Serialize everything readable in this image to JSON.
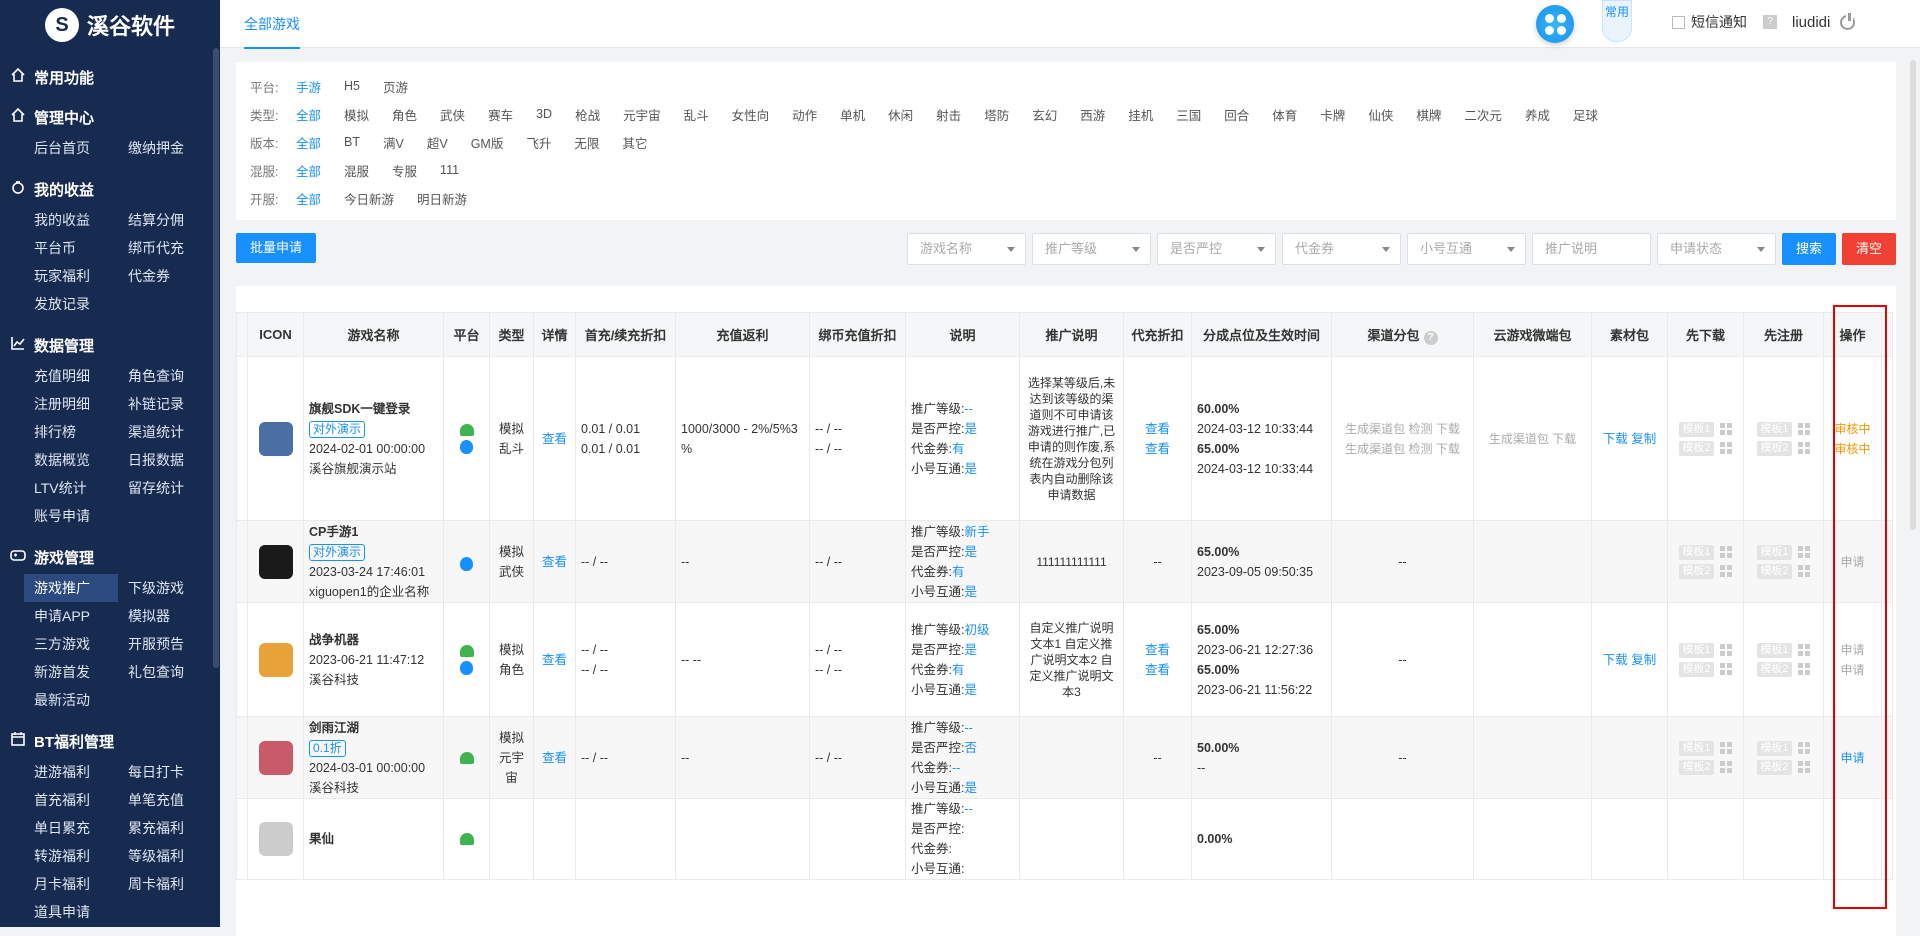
{
  "brand": {
    "name": "溪谷软件",
    "glyph": "S"
  },
  "sidebar": {
    "sections": [
      {
        "title": "常用功能",
        "icon": "home-icon",
        "items": []
      },
      {
        "title": "管理中心",
        "icon": "home-icon",
        "items": [
          "后台首页",
          "缴纳押金"
        ]
      },
      {
        "title": "我的收益",
        "icon": "money-bag-icon",
        "items": [
          "我的收益",
          "结算分佣",
          "平台币",
          "绑币代充",
          "玩家福利",
          "代金券",
          "发放记录"
        ]
      },
      {
        "title": "数据管理",
        "icon": "chart-line-icon",
        "items": [
          "充值明细",
          "角色查询",
          "注册明细",
          "补链记录",
          "排行榜",
          "渠道统计",
          "数据概览",
          "日报数据",
          "LTV统计",
          "留存统计",
          "账号申请"
        ]
      },
      {
        "title": "游戏管理",
        "icon": "gamepad-icon",
        "items": [
          "游戏推广",
          "下级游戏",
          "申请APP",
          "模拟器",
          "三方游戏",
          "开服预告",
          "新游首发",
          "礼包查询",
          "最新活动"
        ]
      },
      {
        "title": "BT福利管理",
        "icon": "calendar-icon",
        "items": [
          "进游福利",
          "每日打卡",
          "首充福利",
          "单笔充值",
          "单日累充",
          "累充福利",
          "转游福利",
          "等级福利",
          "月卡福利",
          "周卡福利",
          "道具申请"
        ]
      }
    ],
    "active_item": "游戏推广"
  },
  "topbar": {
    "tab": "全部游戏",
    "common": "常用",
    "sms": "短信通知",
    "help": "?",
    "user": "liudidi"
  },
  "filters": [
    {
      "label": "平台:",
      "options": [
        "手游",
        "H5",
        "页游"
      ],
      "selected": 0
    },
    {
      "label": "类型:",
      "options": [
        "全部",
        "模拟",
        "角色",
        "武侠",
        "赛车",
        "3D",
        "枪战",
        "元宇宙",
        "乱斗",
        "女性向",
        "动作",
        "单机",
        "休闲",
        "射击",
        "塔防",
        "玄幻",
        "西游",
        "挂机",
        "三国",
        "回合",
        "体育",
        "卡牌",
        "仙侠",
        "棋牌",
        "二次元",
        "养成",
        "足球"
      ],
      "selected": 0
    },
    {
      "label": "版本:",
      "options": [
        "全部",
        "BT",
        "满V",
        "超V",
        "GM版",
        "飞升",
        "无限",
        "其它"
      ],
      "selected": 0
    },
    {
      "label": "混服:",
      "options": [
        "全部",
        "混服",
        "专服",
        "111"
      ],
      "selected": 0
    },
    {
      "label": "开服:",
      "options": [
        "全部",
        "今日新游",
        "明日新游"
      ],
      "selected": 0
    }
  ],
  "toolbar": {
    "batch": "批量申请",
    "selects": [
      "游戏名称",
      "推广等级",
      "是否严控",
      "代金券",
      "小号互通"
    ],
    "input": "推广说明",
    "status": "申请状态",
    "search": "搜索",
    "clear": "清空"
  },
  "table": {
    "headers": [
      "ICON",
      "游戏名称",
      "平台",
      "类型",
      "详情",
      "首充/续充折扣",
      "充值返利",
      "绑币充值折扣",
      "说明",
      "推广说明",
      "代充折扣",
      "分成点位及生效时间",
      "渠道分包",
      "云游戏微端包",
      "素材包",
      "先下载",
      "先注册",
      "操作"
    ],
    "labels": {
      "level": "推广等级:",
      "strict": "是否严控:",
      "voucher": "代金券:",
      "alt": "小号互通:",
      "view": "查看",
      "gen": "生成渠道包",
      "check": "检测",
      "download": "下载",
      "copy": "复制",
      "cloud_gen": "生成渠道包",
      "tpl1": "模板1",
      "tpl2": "模板2"
    },
    "rows": [
      {
        "name": "旗舰SDK一键登录",
        "tag": "对外演示",
        "date": "2024-02-01 00:00:00",
        "company": "溪谷旗舰演示站",
        "icon_color": "#4a6fa5",
        "platforms": [
          "android",
          "ios"
        ],
        "type1": "模拟",
        "type2": "乱斗",
        "discount": [
          "0.01 / 0.01",
          "0.01 / 0.01"
        ],
        "rebate": "1000/3000 - 2%/5%3 %",
        "bind": [
          "-- / --",
          "-- / --"
        ],
        "level": "--",
        "strict": "是",
        "voucher": "有",
        "alt": "是",
        "promo": "选择某等级后,未达到该等级的渠道则不可申请该游戏进行推广,已申请的则作废,系统在游戏分包列表内自动删除该申请数据",
        "agent": [
          "查看",
          "查看"
        ],
        "share": [
          [
            "60.00%",
            "2024-03-12 10:33:44"
          ],
          [
            "65.00%",
            "2024-03-12 10:33:44"
          ]
        ],
        "channel": true,
        "cloud": true,
        "material": true,
        "ops": [
          "审核中",
          "审核中"
        ],
        "op_color": "orange"
      },
      {
        "name": "CP手游1",
        "tag": "对外演示",
        "date": "2023-03-24 17:46:01",
        "company": "xiguopen1的企业名称",
        "icon_color": "#1a1a1a",
        "platforms": [
          "ios"
        ],
        "type1": "模拟",
        "type2": "武侠",
        "discount": [
          "-- / --"
        ],
        "rebate": "--",
        "bind": [
          "-- / --"
        ],
        "level": "新手",
        "strict": "是",
        "voucher": "有",
        "alt": "是",
        "promo": "111111111111",
        "agent": [
          "--"
        ],
        "share": [
          [
            "65.00%",
            "2023-09-05 09:50:35"
          ]
        ],
        "channel": false,
        "cloud_text": "--",
        "material": false,
        "ops": [
          "申请"
        ],
        "op_color": "gray"
      },
      {
        "name": "战争机器",
        "tag": "",
        "date": "2023-06-21 11:47:12",
        "company": "溪谷科技",
        "icon_color": "#e8a23a",
        "platforms": [
          "android",
          "ios"
        ],
        "type1": "模拟",
        "type2": "角色",
        "discount": [
          "-- / --",
          "-- / --"
        ],
        "rebate": "-- --",
        "bind": [
          "-- / --",
          "-- / --"
        ],
        "level": "初级",
        "strict": "是",
        "voucher": "有",
        "alt": "是",
        "promo": "自定义推广说明文本1 自定义推广说明文本2 自定义推广说明文本3",
        "agent": [
          "查看",
          "查看"
        ],
        "share": [
          [
            "65.00%",
            "2023-06-21 12:27:36"
          ],
          [
            "65.00%",
            "2023-06-21 11:56:22"
          ]
        ],
        "channel": false,
        "cloud_text": "--",
        "material": true,
        "ops": [
          "申请",
          "申请"
        ],
        "op_color": "gray"
      },
      {
        "name": "剑雨江湖",
        "tag": "0.1折",
        "date": "2024-03-01 00:00:00",
        "company": "溪谷科技",
        "icon_color": "#c85a6a",
        "platforms": [
          "android"
        ],
        "type1": "模拟",
        "type2": "元宇宙",
        "discount": [
          "-- / --"
        ],
        "rebate": "--",
        "bind": [
          "-- / --"
        ],
        "level": "--",
        "strict": "否",
        "voucher": "--",
        "alt": "是",
        "promo": "",
        "agent": [
          "--"
        ],
        "share": [
          [
            "50.00%",
            "--"
          ]
        ],
        "channel": false,
        "cloud_text": "--",
        "material": false,
        "ops": [
          "申请"
        ],
        "op_color": "blue"
      },
      {
        "name": "果仙",
        "tag": "",
        "date": "",
        "company": "",
        "icon_color": "#cccccc",
        "platforms": [
          "android"
        ],
        "type1": "",
        "type2": "",
        "discount": [
          ""
        ],
        "rebate": "",
        "bind": [
          ""
        ],
        "level": "--",
        "strict": "",
        "voucher": "",
        "alt": "",
        "promo": "",
        "agent": [
          ""
        ],
        "share": [
          [
            "0.00%",
            ""
          ]
        ],
        "channel": false,
        "cloud_text": "",
        "material": false,
        "ops": [
          ""
        ],
        "op_color": "gray"
      }
    ]
  }
}
